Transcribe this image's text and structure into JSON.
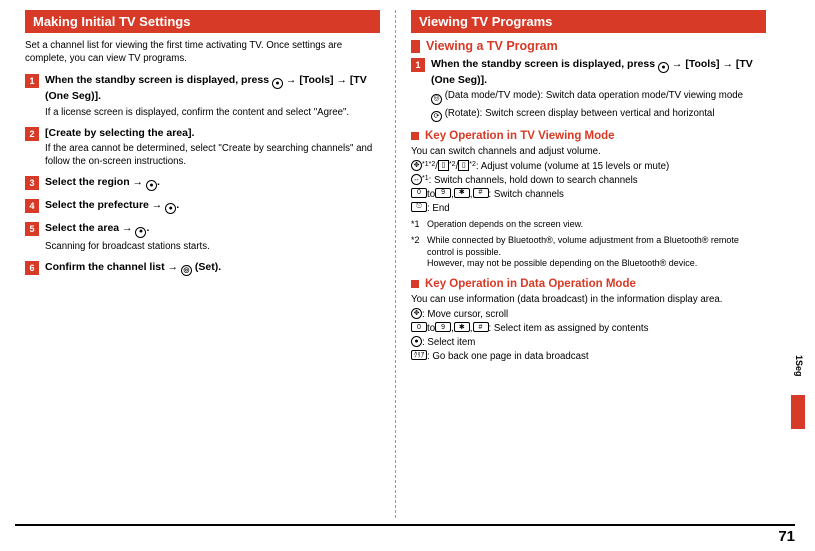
{
  "left": {
    "section_title": "Making Initial TV Settings",
    "intro": "Set a channel list for viewing the first time activating TV. Once settings are complete, you can view TV programs.",
    "steps": [
      {
        "title_html": "When the standby screen is displayed, press ● → [Tools] → [TV (One Seg)].",
        "desc": "If a license screen is displayed, confirm the content and select \"Agree\"."
      },
      {
        "title_html": "[Create by selecting the area].",
        "desc": "If the area cannot be determined, select \"Create by searching channels\" and follow the on-screen instructions."
      },
      {
        "title_html": "Select the region → ●.",
        "desc": ""
      },
      {
        "title_html": "Select the prefecture → ●.",
        "desc": ""
      },
      {
        "title_html": "Select the area → ●.",
        "desc": "Scanning for broadcast stations starts."
      },
      {
        "title_html": "Confirm the channel list → ◎ (Set).",
        "desc": ""
      }
    ]
  },
  "right": {
    "section_title": "Viewing TV Programs",
    "sub_title": "Viewing a TV Program",
    "step1_title": "When the standby screen is displayed, press ● → [Tools] → [TV (One Seg)].",
    "mode_line1_prefix": " (Data mode/TV mode): ",
    "mode_line1": "Switch data operation mode/TV viewing mode",
    "mode_line1_indent": "mode",
    "mode_line2_prefix": " (Rotate): ",
    "mode_line2": "Switch screen display between vertical and horizontal",
    "inner1_title": "Key Operation in TV Viewing Mode",
    "inner1_intro": "You can switch channels and adjust volume.",
    "inner1_lines": {
      "l1": " : Adjust volume (volume at 15 levels or mute)",
      "l2": ": Switch channels, hold down to search channels",
      "l3": ": Switch channels",
      "l4": ": End"
    },
    "fn1_num": "*1",
    "fn1": "Operation depends on the screen view.",
    "fn2_num": "*2",
    "fn2a": "While connected by Bluetooth®, volume adjustment from a Bluetooth® remote control is possible.",
    "fn2b": "However, may not be possible depending on the Bluetooth® device.",
    "inner2_title": "Key Operation in Data Operation Mode",
    "inner2_intro": "You can use information (data broadcast) in the information display area.",
    "inner2_lines": {
      "l1": ": Move cursor, scroll",
      "l2": ": Select item as assigned by contents",
      "l3": ": Select item",
      "l4": ": Go back one page in data broadcast"
    },
    "key_to": " to ",
    "key_comma": " , "
  },
  "page_number": "71",
  "tab_label": "1Seg"
}
